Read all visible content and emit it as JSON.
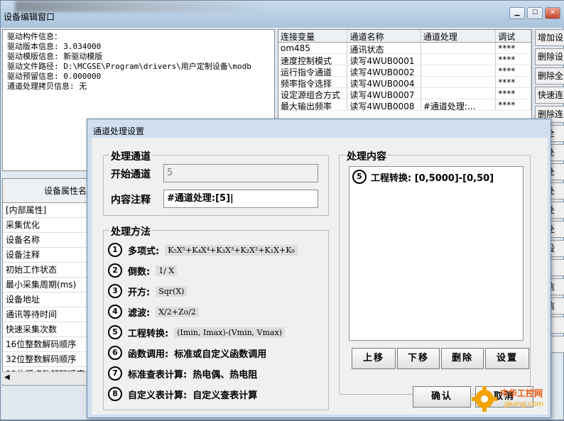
{
  "window": {
    "title": "设备编辑窗口"
  },
  "info_lines": [
    "驱动构件信息：",
    "驱动版本信息: 3.034000",
    "驱动模版信息: 新驱动模版",
    "驱动文件路径: D:\\MCGSE\\Program\\drivers\\用户定制设备\\modb",
    "驱动预留信息: 0.000000",
    "通道处理拷贝信息: 无"
  ],
  "channel_table": {
    "headers": [
      "连接变量",
      "通道名称",
      "通道处理",
      "调试"
    ],
    "rows": [
      [
        "om485",
        "通讯状态",
        "",
        "****"
      ],
      [
        "速度控制模式",
        "读写4WUB0001",
        "",
        "****"
      ],
      [
        "运行指令通道",
        "读写4WUB0002",
        "",
        "****"
      ],
      [
        "频率指令选择",
        "读写4WUB0004",
        "",
        "****"
      ],
      [
        "设定源组合方式",
        "读写4WUB0007",
        "",
        "****"
      ],
      [
        "最大输出频率",
        "读写4WUB0008",
        "#通道处理:...",
        "****"
      ]
    ]
  },
  "right_buttons": [
    "增加设",
    "删除设",
    "删除全",
    "快速连",
    "删除连",
    "除全",
    "道处",
    "道处",
    "道处",
    "道处",
    "道处",
    "动设",
    "设",
    "备信",
    "备信",
    "设",
    "组"
  ],
  "properties": {
    "header": "设备属性名",
    "rows": [
      "[内部属性]",
      "采集优化",
      "设备名称",
      "设备注释",
      "初始工作状态",
      "最小采集周期(ms)",
      "设备地址",
      "通讯等待时间",
      "快速采集次数",
      "16位整数解码顺序",
      "32位整数解码顺序",
      "32位浮点数解码顺序"
    ]
  },
  "dialog": {
    "title": "通道处理设置",
    "group_channel": "处理通道",
    "start_label": "开始通道",
    "start_value": "5",
    "note_label": "内容注释",
    "note_value": "#通道处理:[5]|",
    "group_method": "处理方法",
    "methods": [
      {
        "num": "1",
        "name": "多项式:",
        "formula": "K₅X⁵+K₄X⁴+K₃X³+K₂X²+K₁X+K₀"
      },
      {
        "num": "2",
        "name": "倒数:",
        "formula": "1/ X"
      },
      {
        "num": "3",
        "name": "开方:",
        "formula": "Sqr(X)"
      },
      {
        "num": "4",
        "name": "滤波:",
        "formula": "X/2+Zo/2"
      },
      {
        "num": "5",
        "name": "工程转换:",
        "formula": "(Imin, Imax)-(Vmin, Vmax)"
      },
      {
        "num": "6",
        "name": "函数调用:",
        "desc": "标准或自定义函数调用"
      },
      {
        "num": "7",
        "name": "标准查表计算:",
        "desc": "热电偶、热电阻"
      },
      {
        "num": "8",
        "name": "自定义表计算:",
        "desc": "自定义查表计算"
      }
    ],
    "group_content": "处理内容",
    "content_item": {
      "num": "5",
      "text": "工程转换: [0,5000]-[0,50]"
    },
    "btn_up": "上移",
    "btn_down": "下移",
    "btn_delete": "删除",
    "btn_settings": "设置",
    "btn_ok": "确认",
    "btn_cancel": "取消"
  },
  "watermark": {
    "brand": "中华工控网",
    "url": "gkong.com"
  },
  "colors": {
    "title_bar": "#b8cfe6",
    "dialog_frame": "#cfdff0",
    "dialog_body": "#f0f0f0",
    "accent_orange": "#f2a400"
  }
}
